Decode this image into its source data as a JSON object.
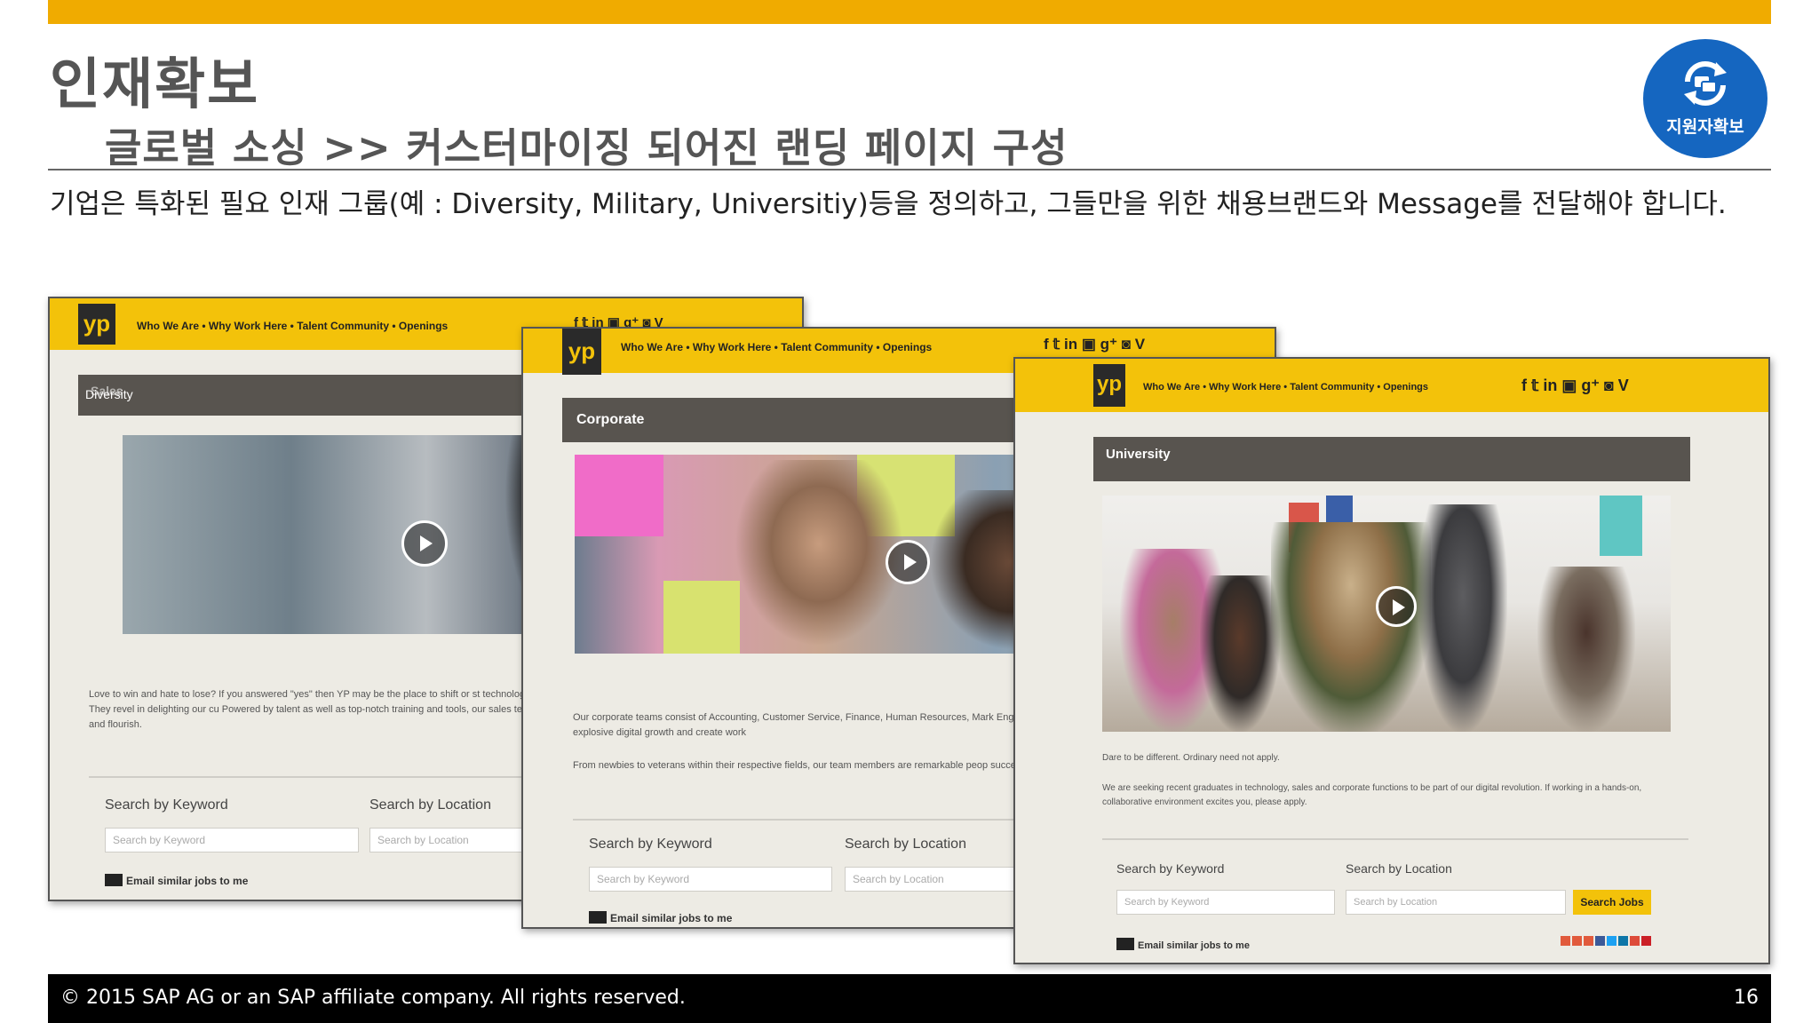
{
  "slide": {
    "title": "인재확보",
    "subtitle": "글로벌 소싱 >> 커스터마이징 되어진 랜딩 페이지 구성",
    "description": "기업은 특화된 필요 인재 그룹(예 : Diversity, Military, Universitiy)등을 정의하고, 그들만을 위한 채용브랜드와 Message를 전달해야 합니다.",
    "badge_label": "지원자확보",
    "footer_copyright": "©  2015 SAP AG or an SAP affiliate  company. All rights reserved.",
    "page_number": "16"
  },
  "nav": {
    "logo": "yp",
    "links": "Who We Are  •  Why Work Here  •  Talent Community  •  Openings",
    "social": "f  𝕥  in  ▣  g⁺  ◙  V"
  },
  "screens": {
    "diversity": {
      "section": "Diversity",
      "section_overlap": "Sales",
      "body": "Love to win and hate to lose? If you answered \"yes\" then YP may be the place to shift or st technology and services that help small businesses prosper. They revel in delighting our cu Powered by talent as well as top-notch training and tools, our sales team members strive t opportunities to learn, grow and flourish.",
      "kw_label": "Search by Keyword",
      "kw_placeholder": "Search by Keyword",
      "loc_label": "Search by Location",
      "loc_placeholder": "Search by Location",
      "email": "Email similar jobs to me"
    },
    "corporate": {
      "section": "Corporate",
      "body1": "Our corporate teams consist of Accounting, Customer Service, Finance, Human Resources, Mark Engine Marketing (SEM) and Strategy that support YP's explosive digital growth and create work",
      "body2": "From newbies to veterans within their respective fields, our team members are remarkable peop success.",
      "kw_label": "Search by Keyword",
      "kw_placeholder": "Search by Keyword",
      "loc_label": "Search by Location",
      "loc_placeholder": "Search by Location",
      "email": "Email similar jobs to me"
    },
    "university": {
      "section": "University",
      "body1": "Dare to be different. Ordinary need not apply.",
      "body2": "We are seeking recent graduates in technology, sales and corporate functions to be part of our digital revolution. If working in a hands-on, collaborative environment excites you, please apply.",
      "kw_label": "Search by Keyword",
      "kw_placeholder": "Search by Keyword",
      "loc_label": "Search by Location",
      "loc_placeholder": "Search by Location",
      "search_button": "Search Jobs",
      "email": "Email similar jobs to me"
    }
  },
  "colors": {
    "accent": "#f0ab00",
    "yp_yellow": "#f3c20a",
    "badge_blue": "#1566c0",
    "section_gray": "#58544f"
  }
}
